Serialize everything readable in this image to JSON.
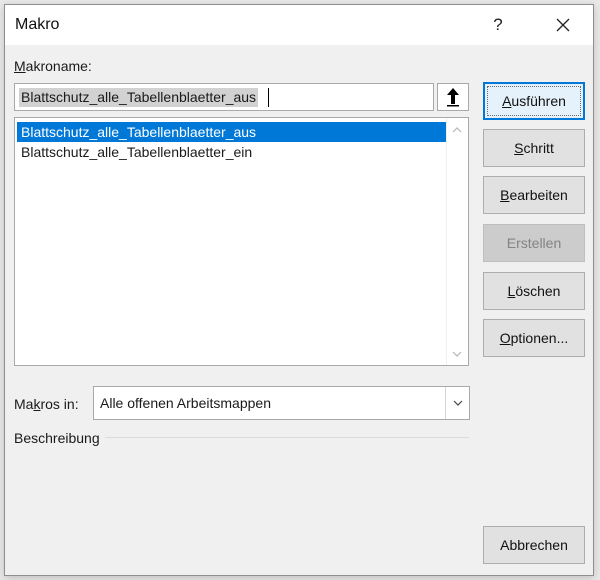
{
  "window": {
    "title": "Makro",
    "help_label": "?"
  },
  "macro_name": {
    "label": "Makroname:",
    "label_access_key": "M",
    "label_rest": "akroname:",
    "value": "Blattschutz_alle_Tabellenblaetter_aus"
  },
  "macro_list": {
    "items": [
      {
        "label": "Blattschutz_alle_Tabellenblaetter_aus",
        "selected": true
      },
      {
        "label": "Blattschutz_alle_Tabellenblaetter_ein",
        "selected": false
      }
    ]
  },
  "macros_in": {
    "label": "Makros in:",
    "label_pre": "Ma",
    "label_access_key": "k",
    "label_post": "ros in:",
    "value": "Alle offenen Arbeitsmappen"
  },
  "description": {
    "label": "Beschreibung"
  },
  "buttons": {
    "run": {
      "pre": "",
      "key": "A",
      "post": "usführen",
      "label": "Ausführen",
      "enabled": true
    },
    "step": {
      "pre": "",
      "key": "S",
      "post": "chritt",
      "label": "Schritt",
      "enabled": true
    },
    "edit": {
      "pre": "",
      "key": "B",
      "post": "earbeiten",
      "label": "Bearbeiten",
      "enabled": true
    },
    "create": {
      "label": "Erstellen",
      "enabled": false
    },
    "delete": {
      "pre": "",
      "key": "L",
      "post": "öschen",
      "label": "Löschen",
      "enabled": true
    },
    "options": {
      "pre": "",
      "key": "O",
      "post": "ptionen...",
      "label": "Optionen...",
      "enabled": true
    },
    "cancel": {
      "label": "Abbrechen",
      "enabled": true
    }
  },
  "colors": {
    "selection": "#0078d7",
    "dialog_bg": "#f0f0f0",
    "disabled_button": "#cccccc"
  }
}
